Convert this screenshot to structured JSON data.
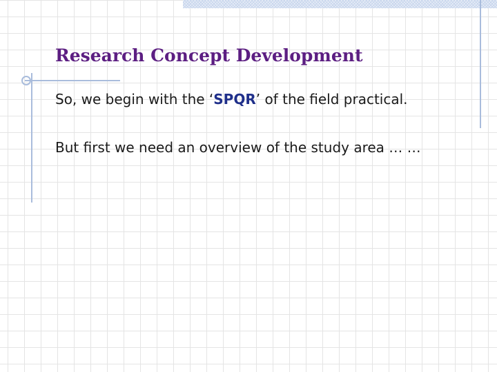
{
  "slide": {
    "title": "Research Concept Development",
    "line1": {
      "prefix": "So, we begin with the ‘",
      "emphasis": "SPQR",
      "suffix": "’ of the field practical."
    },
    "line2": "But first we need an overview of the study area … …"
  },
  "colors": {
    "title": "#5c1e82",
    "emphasis": "#1f2f8a",
    "accent_rule": "#a9bcdc",
    "grid": "#e4e4e4"
  },
  "icons": [
    "crosshair-icon"
  ]
}
